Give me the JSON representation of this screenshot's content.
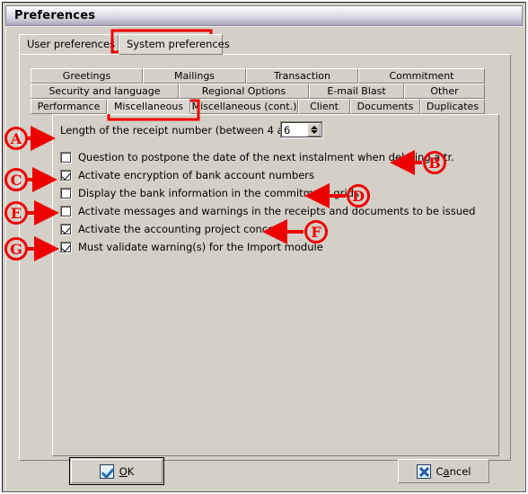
{
  "window": {
    "title": "Preferences"
  },
  "top_tabs": [
    {
      "label": "User preferences",
      "selected": false
    },
    {
      "label": "System preferences",
      "selected": true
    }
  ],
  "inner_tabs": {
    "row1": [
      {
        "label": "Greetings",
        "active": false
      },
      {
        "label": "Mailings",
        "active": false
      },
      {
        "label": "Transaction",
        "active": false
      },
      {
        "label": "Commitment",
        "active": false
      }
    ],
    "row2": [
      {
        "label": "Security and language",
        "active": false
      },
      {
        "label": "Regional Options",
        "active": false
      },
      {
        "label": "E-mail Blast",
        "active": false
      },
      {
        "label": "Other",
        "active": false
      }
    ],
    "row3": [
      {
        "label": "Performance",
        "active": false
      },
      {
        "label": "Miscellaneous",
        "active": true
      },
      {
        "label": "Miscellaneous (cont.)",
        "active": false
      },
      {
        "label": "Client",
        "active": false
      },
      {
        "label": "Documents",
        "active": false
      },
      {
        "label": "Duplicates",
        "active": false
      }
    ]
  },
  "content": {
    "receipt_length_label": "Length of the receipt number (between 4 and 10):",
    "receipt_length_value": "6",
    "options": [
      {
        "label": "Question to postpone the date of the next instalment when deleting a tr.",
        "checked": false
      },
      {
        "label": "Activate encryption of bank account numbers",
        "checked": true
      },
      {
        "label": "Display the bank information in the commitment grids",
        "checked": false
      },
      {
        "label": "Activate messages and warnings in the receipts and documents to be issued",
        "checked": false
      },
      {
        "label": "Activate the accounting project concept",
        "checked": true
      },
      {
        "label": "Must validate warning(s) for the Import module",
        "checked": true
      }
    ]
  },
  "buttons": {
    "ok": {
      "label_pre": "",
      "label_accel": "O",
      "label_post": "K",
      "label": "OK",
      "icon": "check-icon"
    },
    "cancel": {
      "label": "Cancel",
      "icon": "x-icon"
    }
  },
  "annotations": {
    "markers": [
      {
        "id": "A",
        "letter": "A"
      },
      {
        "id": "B",
        "letter": "B"
      },
      {
        "id": "C",
        "letter": "C"
      },
      {
        "id": "D",
        "letter": "D"
      },
      {
        "id": "E",
        "letter": "E"
      },
      {
        "id": "F",
        "letter": "F"
      },
      {
        "id": "G",
        "letter": "G"
      }
    ],
    "color": "#ee0000"
  }
}
